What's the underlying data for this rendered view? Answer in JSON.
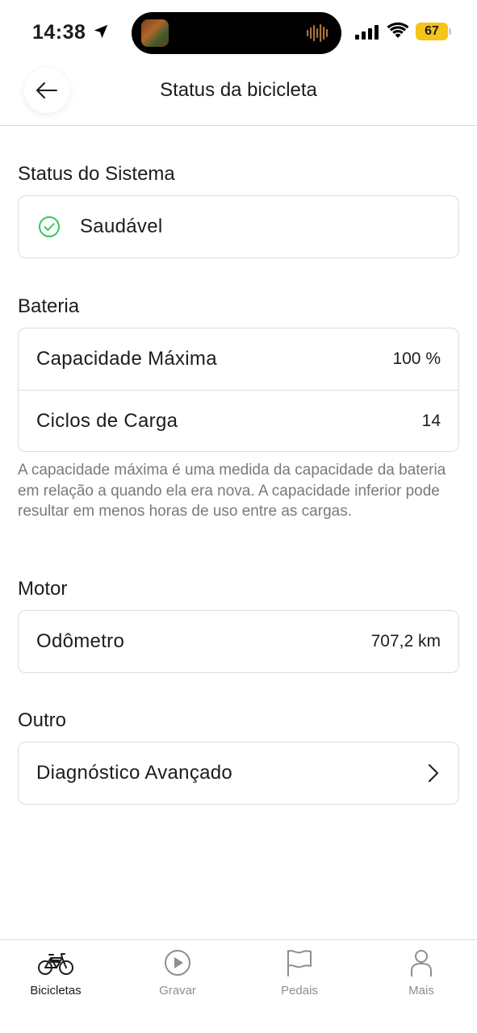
{
  "status_bar": {
    "time": "14:38",
    "battery": "67",
    "battery_color": "#f5c518"
  },
  "header": {
    "title": "Status da bicicleta",
    "back_icon": "arrow-left-icon"
  },
  "system": {
    "title": "Status do Sistema",
    "status": "Saudável",
    "status_icon": "check-circle-icon",
    "status_color": "#34c759"
  },
  "battery_section": {
    "title": "Bateria",
    "rows": [
      {
        "label": "Capacidade Máxima",
        "value": "100 %"
      },
      {
        "label": "Ciclos de Carga",
        "value": "14"
      }
    ],
    "note": "A capacidade máxima é uma medida da capacidade da bateria em relação a quando ela era nova. A capacidade inferior pode resultar em menos horas de uso entre as cargas."
  },
  "motor": {
    "title": "Motor",
    "rows": [
      {
        "label": "Odômetro",
        "value": "707,2 km"
      }
    ]
  },
  "other": {
    "title": "Outro",
    "rows": [
      {
        "label": "Diagnóstico Avançado",
        "icon": "chevron-right-icon"
      }
    ]
  },
  "tabs": [
    {
      "label": "Bicicletas",
      "icon": "bicycle-icon",
      "active": true
    },
    {
      "label": "Gravar",
      "icon": "play-circle-icon",
      "active": false
    },
    {
      "label": "Pedais",
      "icon": "flag-icon",
      "active": false
    },
    {
      "label": "Mais",
      "icon": "person-icon",
      "active": false
    }
  ]
}
